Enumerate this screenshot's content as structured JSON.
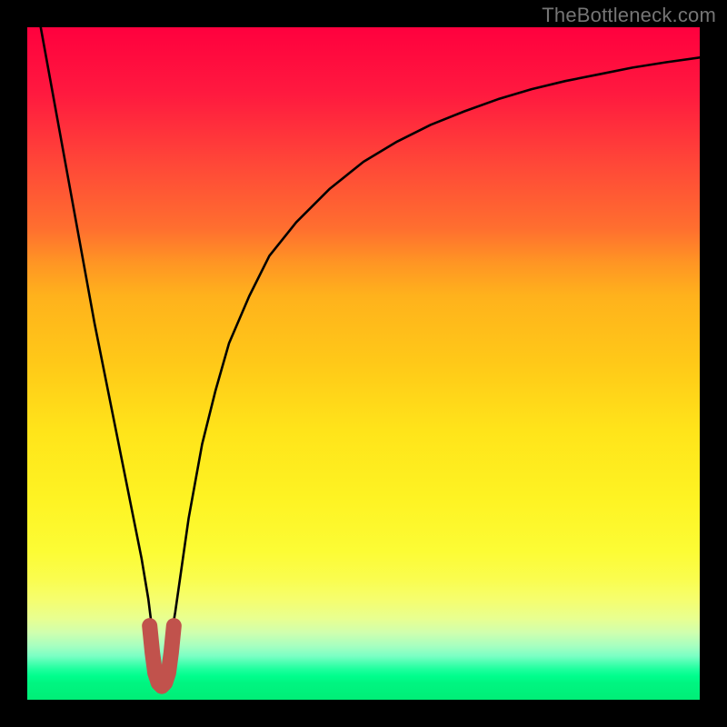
{
  "watermark": "TheBottleneck.com",
  "chart_data": {
    "type": "line",
    "title": "",
    "xlabel": "",
    "ylabel": "",
    "xlim": [
      0,
      100
    ],
    "ylim": [
      0,
      100
    ],
    "grid": false,
    "legend": false,
    "series": [
      {
        "name": "bottleneck-curve",
        "x": [
          2,
          4,
          6,
          8,
          10,
          12,
          14,
          16,
          17,
          18,
          18.5,
          19,
          19.5,
          20,
          20.5,
          21,
          22,
          23,
          24,
          26,
          28,
          30,
          33,
          36,
          40,
          45,
          50,
          55,
          60,
          65,
          70,
          75,
          80,
          85,
          90,
          95,
          100
        ],
        "y": [
          100,
          89,
          78,
          67,
          56,
          46,
          36,
          26,
          21,
          15,
          11,
          7,
          3,
          2,
          3,
          7,
          13,
          20,
          27,
          38,
          46,
          53,
          60,
          66,
          71,
          76,
          80,
          83,
          85.5,
          87.5,
          89.3,
          90.8,
          92,
          93,
          94,
          94.8,
          95.5
        ]
      }
    ],
    "marker": {
      "name": "highlight-region",
      "color": "#c1524c",
      "points": [
        {
          "x": 18.2,
          "y": 11
        },
        {
          "x": 18.6,
          "y": 7
        },
        {
          "x": 19.0,
          "y": 4
        },
        {
          "x": 19.5,
          "y": 2.5
        },
        {
          "x": 20.0,
          "y": 2
        },
        {
          "x": 20.5,
          "y": 2.5
        },
        {
          "x": 21.0,
          "y": 4
        },
        {
          "x": 21.4,
          "y": 7
        },
        {
          "x": 21.8,
          "y": 11
        }
      ]
    },
    "background_gradient": {
      "top": "#ff003e",
      "mid": "#ffe41a",
      "bottom": "#00ee77"
    }
  }
}
